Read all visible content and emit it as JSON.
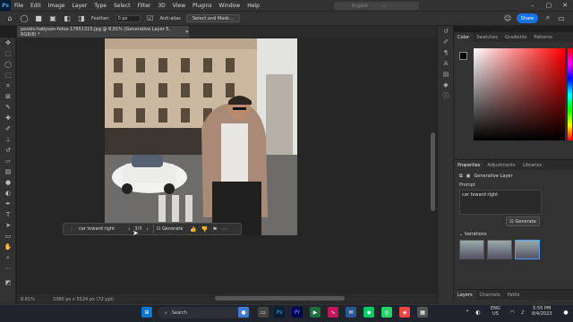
{
  "menu": {
    "app_icon": "Ps",
    "items": [
      "File",
      "Edit",
      "Image",
      "Layer",
      "Type",
      "Select",
      "Filter",
      "3D",
      "View",
      "Plugins",
      "Window",
      "Help"
    ],
    "center_label": "English"
  },
  "options_bar": {
    "feather_label": "Feather:",
    "feather_value": "0 px",
    "antialias_label": "Anti-alias",
    "select_mask": "Select and Mask...",
    "share": "Share"
  },
  "document": {
    "tab_title": "pexels-habyson-fotos-17651315.jpg @ 8.81% (Generative Layer 5, RGB/8) *",
    "zoom": "8.81%",
    "dimensions": "3380 px x 5524 px (72 ppi)"
  },
  "context_bar": {
    "prompt": "car toward right",
    "counter": "3/3",
    "generate": "Generate"
  },
  "color_panel": {
    "tabs": [
      "Color",
      "Swatches",
      "Gradients",
      "Patterns"
    ]
  },
  "properties_panel": {
    "tabs": [
      "Properties",
      "Adjustments",
      "Libraries"
    ],
    "layer_type": "Generative Layer",
    "prompt_label": "Prompt",
    "prompt_value": "car toward right",
    "generate": "Generate",
    "variations_label": "Variations"
  },
  "layers_panel": {
    "tabs": [
      "Layers",
      "Channels",
      "Paths"
    ]
  },
  "taskbar": {
    "search": "Search",
    "lang_top": "ENG",
    "lang_bottom": "US",
    "time": "5:55 PM",
    "date": "8/4/2023"
  }
}
